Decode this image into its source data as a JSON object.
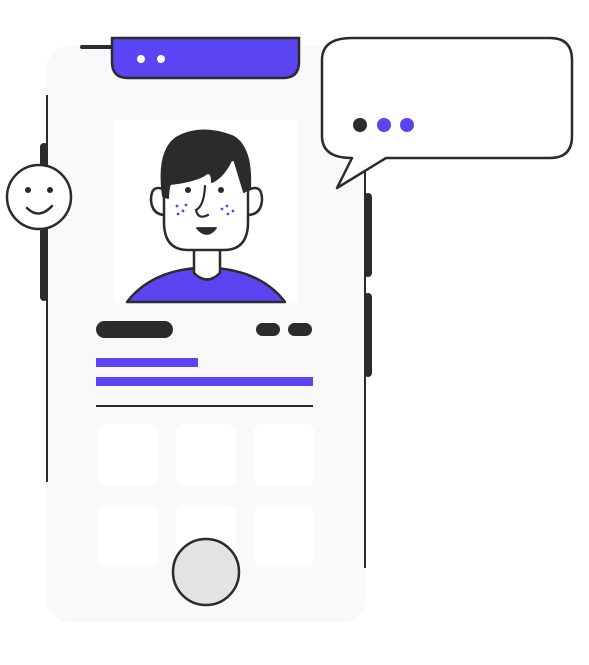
{
  "illustration": {
    "subject": "phone-profile-chat",
    "speech_bubble": {
      "typing_dots": [
        "#2b2b2b",
        "#5b45f2",
        "#5b45f2"
      ]
    },
    "phone": {
      "notch_dots": 2,
      "grid_tiles": 6,
      "progress_bars": [
        0.47,
        1.0
      ]
    },
    "colors": {
      "accent": "#5b45f2",
      "ink": "#2b2b2b",
      "phone_body": "#f9f9fc",
      "tile": "#ffffff",
      "home_button": "#e3e3e3",
      "skin": "#ffffff",
      "hair": "#2b2b2b"
    }
  }
}
